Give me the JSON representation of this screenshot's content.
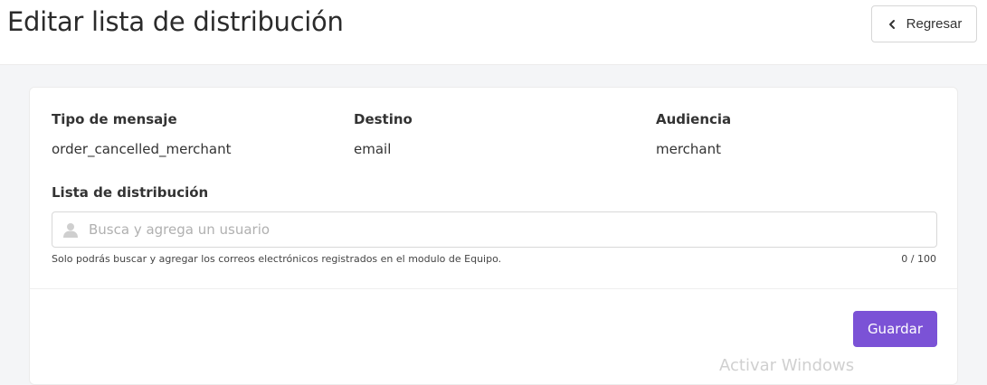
{
  "header": {
    "title": "Editar lista de distribución",
    "back_label": "Regresar"
  },
  "details": {
    "message_type_label": "Tipo de mensaje",
    "message_type_value": "order_cancelled_merchant",
    "destination_label": "Destino",
    "destination_value": "email",
    "audience_label": "Audiencia",
    "audience_value": "merchant"
  },
  "distribution": {
    "label": "Lista de distribución",
    "search_placeholder": "Busca y agrega un usuario",
    "search_value": "",
    "helper_text": "Solo podrás buscar y agregar los correos electrónicos registrados en el modulo de Equipo.",
    "counter": "0 / 100"
  },
  "actions": {
    "save_label": "Guardar"
  },
  "overlay": {
    "watermark_text": "Activar Windows"
  },
  "icons": {
    "back": "chevron-left-icon",
    "user": "user-icon"
  },
  "colors": {
    "primary": "#7b52d6",
    "background": "#f4f5f7"
  }
}
